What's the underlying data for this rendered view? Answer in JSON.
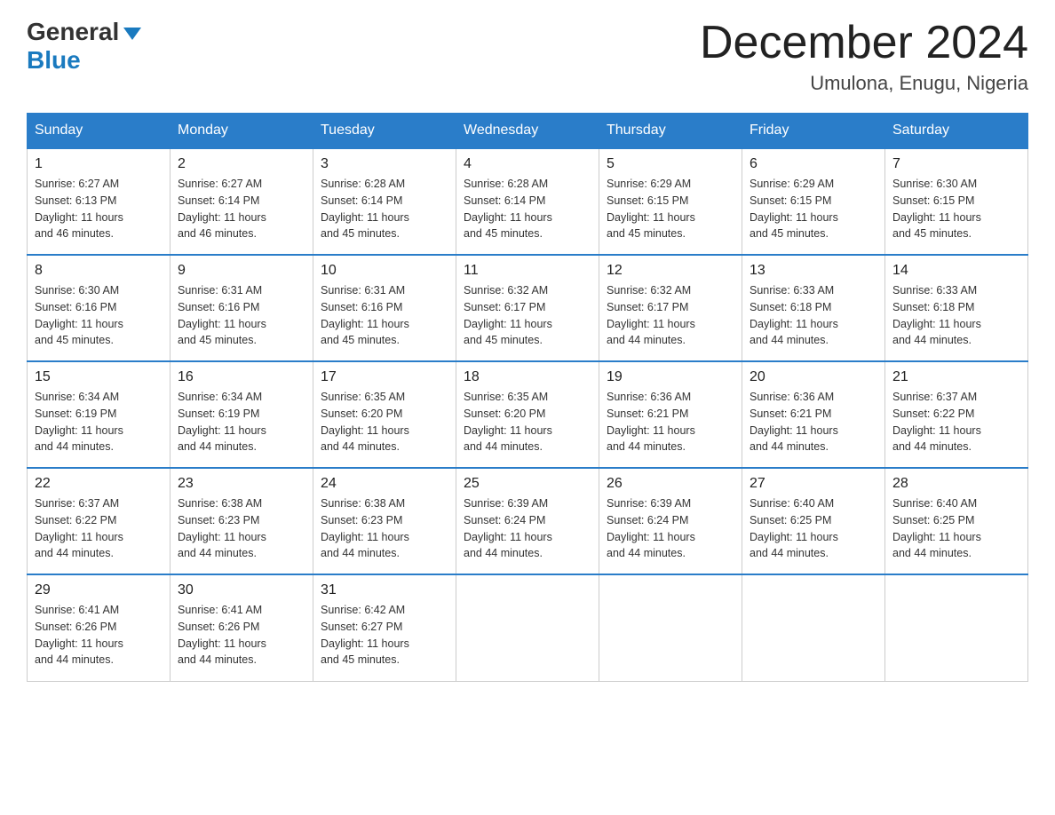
{
  "logo": {
    "general": "General",
    "blue": "Blue"
  },
  "title": "December 2024",
  "location": "Umulona, Enugu, Nigeria",
  "days_of_week": [
    "Sunday",
    "Monday",
    "Tuesday",
    "Wednesday",
    "Thursday",
    "Friday",
    "Saturday"
  ],
  "weeks": [
    [
      {
        "day": "1",
        "sunrise": "6:27 AM",
        "sunset": "6:13 PM",
        "daylight": "11 hours and 46 minutes."
      },
      {
        "day": "2",
        "sunrise": "6:27 AM",
        "sunset": "6:14 PM",
        "daylight": "11 hours and 46 minutes."
      },
      {
        "day": "3",
        "sunrise": "6:28 AM",
        "sunset": "6:14 PM",
        "daylight": "11 hours and 45 minutes."
      },
      {
        "day": "4",
        "sunrise": "6:28 AM",
        "sunset": "6:14 PM",
        "daylight": "11 hours and 45 minutes."
      },
      {
        "day": "5",
        "sunrise": "6:29 AM",
        "sunset": "6:15 PM",
        "daylight": "11 hours and 45 minutes."
      },
      {
        "day": "6",
        "sunrise": "6:29 AM",
        "sunset": "6:15 PM",
        "daylight": "11 hours and 45 minutes."
      },
      {
        "day": "7",
        "sunrise": "6:30 AM",
        "sunset": "6:15 PM",
        "daylight": "11 hours and 45 minutes."
      }
    ],
    [
      {
        "day": "8",
        "sunrise": "6:30 AM",
        "sunset": "6:16 PM",
        "daylight": "11 hours and 45 minutes."
      },
      {
        "day": "9",
        "sunrise": "6:31 AM",
        "sunset": "6:16 PM",
        "daylight": "11 hours and 45 minutes."
      },
      {
        "day": "10",
        "sunrise": "6:31 AM",
        "sunset": "6:16 PM",
        "daylight": "11 hours and 45 minutes."
      },
      {
        "day": "11",
        "sunrise": "6:32 AM",
        "sunset": "6:17 PM",
        "daylight": "11 hours and 45 minutes."
      },
      {
        "day": "12",
        "sunrise": "6:32 AM",
        "sunset": "6:17 PM",
        "daylight": "11 hours and 44 minutes."
      },
      {
        "day": "13",
        "sunrise": "6:33 AM",
        "sunset": "6:18 PM",
        "daylight": "11 hours and 44 minutes."
      },
      {
        "day": "14",
        "sunrise": "6:33 AM",
        "sunset": "6:18 PM",
        "daylight": "11 hours and 44 minutes."
      }
    ],
    [
      {
        "day": "15",
        "sunrise": "6:34 AM",
        "sunset": "6:19 PM",
        "daylight": "11 hours and 44 minutes."
      },
      {
        "day": "16",
        "sunrise": "6:34 AM",
        "sunset": "6:19 PM",
        "daylight": "11 hours and 44 minutes."
      },
      {
        "day": "17",
        "sunrise": "6:35 AM",
        "sunset": "6:20 PM",
        "daylight": "11 hours and 44 minutes."
      },
      {
        "day": "18",
        "sunrise": "6:35 AM",
        "sunset": "6:20 PM",
        "daylight": "11 hours and 44 minutes."
      },
      {
        "day": "19",
        "sunrise": "6:36 AM",
        "sunset": "6:21 PM",
        "daylight": "11 hours and 44 minutes."
      },
      {
        "day": "20",
        "sunrise": "6:36 AM",
        "sunset": "6:21 PM",
        "daylight": "11 hours and 44 minutes."
      },
      {
        "day": "21",
        "sunrise": "6:37 AM",
        "sunset": "6:22 PM",
        "daylight": "11 hours and 44 minutes."
      }
    ],
    [
      {
        "day": "22",
        "sunrise": "6:37 AM",
        "sunset": "6:22 PM",
        "daylight": "11 hours and 44 minutes."
      },
      {
        "day": "23",
        "sunrise": "6:38 AM",
        "sunset": "6:23 PM",
        "daylight": "11 hours and 44 minutes."
      },
      {
        "day": "24",
        "sunrise": "6:38 AM",
        "sunset": "6:23 PM",
        "daylight": "11 hours and 44 minutes."
      },
      {
        "day": "25",
        "sunrise": "6:39 AM",
        "sunset": "6:24 PM",
        "daylight": "11 hours and 44 minutes."
      },
      {
        "day": "26",
        "sunrise": "6:39 AM",
        "sunset": "6:24 PM",
        "daylight": "11 hours and 44 minutes."
      },
      {
        "day": "27",
        "sunrise": "6:40 AM",
        "sunset": "6:25 PM",
        "daylight": "11 hours and 44 minutes."
      },
      {
        "day": "28",
        "sunrise": "6:40 AM",
        "sunset": "6:25 PM",
        "daylight": "11 hours and 44 minutes."
      }
    ],
    [
      {
        "day": "29",
        "sunrise": "6:41 AM",
        "sunset": "6:26 PM",
        "daylight": "11 hours and 44 minutes."
      },
      {
        "day": "30",
        "sunrise": "6:41 AM",
        "sunset": "6:26 PM",
        "daylight": "11 hours and 44 minutes."
      },
      {
        "day": "31",
        "sunrise": "6:42 AM",
        "sunset": "6:27 PM",
        "daylight": "11 hours and 45 minutes."
      },
      null,
      null,
      null,
      null
    ]
  ],
  "labels": {
    "sunrise": "Sunrise:",
    "sunset": "Sunset:",
    "daylight": "Daylight:"
  },
  "colors": {
    "header_bg": "#2a7dc9",
    "header_text": "#ffffff",
    "border_top": "#2a7dc9"
  }
}
